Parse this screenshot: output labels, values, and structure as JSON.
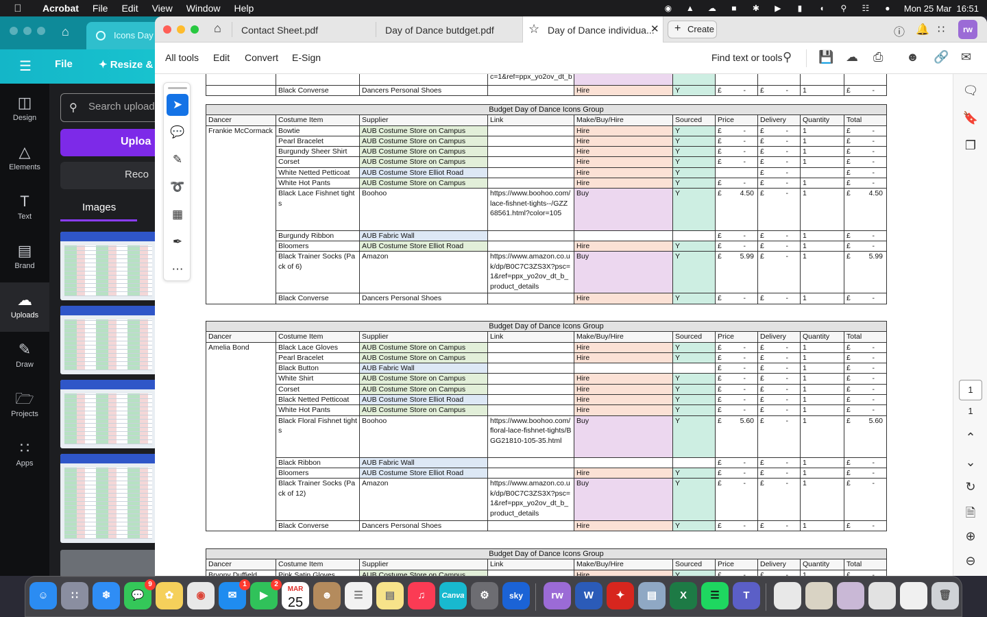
{
  "menubar": {
    "app": "Acrobat",
    "items": [
      "File",
      "Edit",
      "View",
      "Window",
      "Help"
    ],
    "clock": "Mon 25 Mar  16:51"
  },
  "canva": {
    "tab_title": "Icons Day",
    "menu_file": "File",
    "menu_resize": "Resize & M",
    "rail": [
      "Design",
      "Elements",
      "Text",
      "Brand",
      "Uploads",
      "Draw",
      "Projects",
      "Apps"
    ],
    "search_placeholder": "Search upload",
    "upload_btn": "Uploa",
    "record_btn": "Reco",
    "images_tab": "Images"
  },
  "acrobat": {
    "tabs": [
      "Contact Sheet.pdf",
      "Day of Dance butdget.pdf",
      "Day of Dance individua..."
    ],
    "create": "Create",
    "avatar": "rw",
    "toolbar": [
      "All tools",
      "Edit",
      "Convert",
      "E-Sign"
    ],
    "find": "Find text or tools",
    "page_current": "1",
    "page_total": "1"
  },
  "colors": {
    "hire": "#fbe1d5",
    "buy": "#ecd7ef",
    "sourced": "#cdeee2",
    "campus": "#e2efd9",
    "fabric": "#dde8f5",
    "accent": "#1473e6"
  },
  "doc": {
    "top_fragment": {
      "link_tail": "c=1&ref=ppx_yo2ov_dt_b",
      "row": {
        "item": "Black Converse",
        "supplier": "Dancers Personal Shoes",
        "type": "Hire",
        "sourced": "Y",
        "price": "£      -",
        "delivery": "£      -",
        "qty": "1",
        "total": "£      -"
      }
    },
    "headers": [
      "Dancer",
      "Costume Item",
      "Supplier",
      "Link",
      "Make/Buy/Hire",
      "Sourced",
      "Price",
      "Delivery",
      "Quantity",
      "Total"
    ],
    "table_title": "Budget Day of Dance Icons Group",
    "groups": [
      {
        "dancer": "Frankie McCormack",
        "rows": [
          {
            "item": "Bowtie",
            "supplier": "AUB Costume Store on Campus",
            "sc": "g",
            "link": "",
            "type": "Hire",
            "sourced": "Y",
            "price": "-",
            "delivery": "-",
            "qty": "1",
            "total": "-"
          },
          {
            "item": "Pearl Bracelet",
            "supplier": "AUB Costume Store on Campus",
            "sc": "g",
            "link": "",
            "type": "Hire",
            "sourced": "Y",
            "price": "-",
            "delivery": "-",
            "qty": "1",
            "total": "-"
          },
          {
            "item": "Burgundy Sheer Shirt",
            "supplier": "AUB Costume Store on Campus",
            "sc": "g",
            "link": "",
            "type": "Hire",
            "sourced": "Y",
            "price": "-",
            "delivery": "-",
            "qty": "1",
            "total": "-"
          },
          {
            "item": "Corset",
            "supplier": "AUB Costume Store on Campus",
            "sc": "g",
            "link": "",
            "type": "Hire",
            "sourced": "Y",
            "price": "-",
            "delivery": "-",
            "qty": "1",
            "total": "-"
          },
          {
            "item": "White Netted Petticoat",
            "supplier": "AUB Costume Store Elliot Road",
            "sc": "b",
            "link": "",
            "type": "Hire",
            "sourced": "Y",
            "price": "",
            "delivery": "-",
            "qty": "",
            "total": "-"
          },
          {
            "item": "White Hot Pants",
            "supplier": "AUB Costume Store on Campus",
            "sc": "g",
            "link": "",
            "type": "Hire",
            "sourced": "Y",
            "price": "-",
            "delivery": "-",
            "qty": "1",
            "total": "-"
          },
          {
            "item": "Black Lace Fishnet tights",
            "supplier": "Boohoo",
            "sc": "",
            "link": "https://www.boohoo.com/lace-fishnet-tights--/GZZ68561.html?color=105",
            "lines": 4,
            "type": "Buy",
            "sourced": "Y",
            "price": "4.50",
            "delivery": "-",
            "qty": "1",
            "total": "4.50"
          },
          {
            "item": "Burgundy Ribbon",
            "supplier": "AUB Fabric Wall",
            "sc": "b",
            "link": "",
            "type": "",
            "sourced": "",
            "price": "-",
            "delivery": "-",
            "qty": "1",
            "total": "-"
          },
          {
            "item": "Bloomers",
            "supplier": "AUB Costume Store Elliot Road",
            "sc": "g",
            "link": "",
            "type": "Hire",
            "sourced": "Y",
            "price": "-",
            "delivery": "-",
            "qty": "1",
            "total": "-"
          },
          {
            "item": "Black Trainer Socks (Pack of 6)",
            "supplier": "Amazon",
            "sc": "",
            "link": "https://www.amazon.co.uk/dp/B0C7C3ZS3X?psc=1&ref=ppx_yo2ov_dt_b_product_details",
            "lines": 4,
            "type": "Buy",
            "sourced": "Y",
            "price": "5.99",
            "delivery": "-",
            "qty": "1",
            "total": "5.99"
          },
          {
            "item": "Black Converse",
            "supplier": "Dancers Personal Shoes",
            "sc": "",
            "link": "",
            "type": "Hire",
            "sourced": "Y",
            "price": "-",
            "delivery": "-",
            "qty": "1",
            "total": "-"
          }
        ]
      },
      {
        "dancer": "Amelia Bond",
        "rows": [
          {
            "item": "Black Lace Gloves",
            "supplier": "AUB Costume Store on Campus",
            "sc": "g",
            "link": "",
            "type": "Hire",
            "sourced": "Y",
            "price": "-",
            "delivery": "-",
            "qty": "1",
            "total": "-"
          },
          {
            "item": "Pearl Bracelet",
            "supplier": "AUB Costume Store on Campus",
            "sc": "g",
            "link": "",
            "type": "Hire",
            "sourced": "Y",
            "price": "-",
            "delivery": "-",
            "qty": "1",
            "total": "-"
          },
          {
            "item": "Black Button",
            "supplier": "AUB Fabric Wall",
            "sc": "b",
            "link": "",
            "type": "",
            "sourced": "",
            "price": "-",
            "delivery": "-",
            "qty": "1",
            "total": "-"
          },
          {
            "item": "White Shirt",
            "supplier": "AUB Costume Store on Campus",
            "sc": "g",
            "link": "",
            "type": "Hire",
            "sourced": "Y",
            "price": "-",
            "delivery": "-",
            "qty": "1",
            "total": "-"
          },
          {
            "item": "Corset",
            "supplier": "AUB Costume Store on Campus",
            "sc": "g",
            "link": "",
            "type": "Hire",
            "sourced": "Y",
            "price": "-",
            "delivery": "-",
            "qty": "1",
            "total": "-"
          },
          {
            "item": "Black Netted Petticoat",
            "supplier": "AUB Costume Store Elliot Road",
            "sc": "b",
            "link": "",
            "type": "Hire",
            "sourced": "Y",
            "price": "-",
            "delivery": "-",
            "qty": "1",
            "total": "-"
          },
          {
            "item": "White Hot Pants",
            "supplier": "AUB Costume Store on Campus",
            "sc": "g",
            "link": "",
            "type": "Hire",
            "sourced": "Y",
            "price": "-",
            "delivery": "-",
            "qty": "1",
            "total": "-"
          },
          {
            "item": "Black Floral Fishnet tights",
            "supplier": "Boohoo",
            "sc": "",
            "link": "https://www.boohoo.com/floral-lace-fishnet-tights/BGG21810-105-35.html",
            "lines": 4,
            "type": "Buy",
            "sourced": "Y",
            "price": "5.60",
            "delivery": "-",
            "qty": "1",
            "total": "5.60"
          },
          {
            "item": "Black Ribbon",
            "supplier": "AUB Fabric Wall",
            "sc": "b",
            "link": "",
            "type": "",
            "sourced": "",
            "price": "-",
            "delivery": "-",
            "qty": "1",
            "total": "-"
          },
          {
            "item": "Bloomers",
            "supplier": "AUB Costume Store Elliot Road",
            "sc": "b",
            "link": "",
            "type": "Hire",
            "sourced": "Y",
            "price": "-",
            "delivery": "-",
            "qty": "1",
            "total": "-"
          },
          {
            "item": "Black Trainer Socks (Pack of 12)",
            "supplier": "Amazon",
            "sc": "",
            "link": "https://www.amazon.co.uk/dp/B0C7C3ZS3X?psc=1&ref=ppx_yo2ov_dt_b_product_details",
            "lines": 4,
            "type": "Buy",
            "sourced": "Y",
            "price": "-",
            "delivery": "-",
            "qty": "1",
            "total": "-"
          },
          {
            "item": "Black Converse",
            "supplier": "Dancers Personal Shoes",
            "sc": "",
            "link": "",
            "type": "Hire",
            "sourced": "Y",
            "price": "-",
            "delivery": "-",
            "qty": "1",
            "total": "-"
          }
        ]
      },
      {
        "dancer": "Bryony Duffield",
        "rows": [
          {
            "item": "Pink Satin Gloves",
            "supplier": "AUB Costume Store on Campus",
            "sc": "g",
            "link": "",
            "type": "Hire",
            "sourced": "Y",
            "price": "-",
            "delivery": "-",
            "qty": "1",
            "total": "-"
          }
        ]
      }
    ]
  },
  "dock": {
    "badges": {
      "messages": "9",
      "mail": "1",
      "facetime": "2"
    },
    "calendar_month": "MAR",
    "calendar_day": "25",
    "canva_label": "Canva",
    "sky_label": "sky"
  }
}
